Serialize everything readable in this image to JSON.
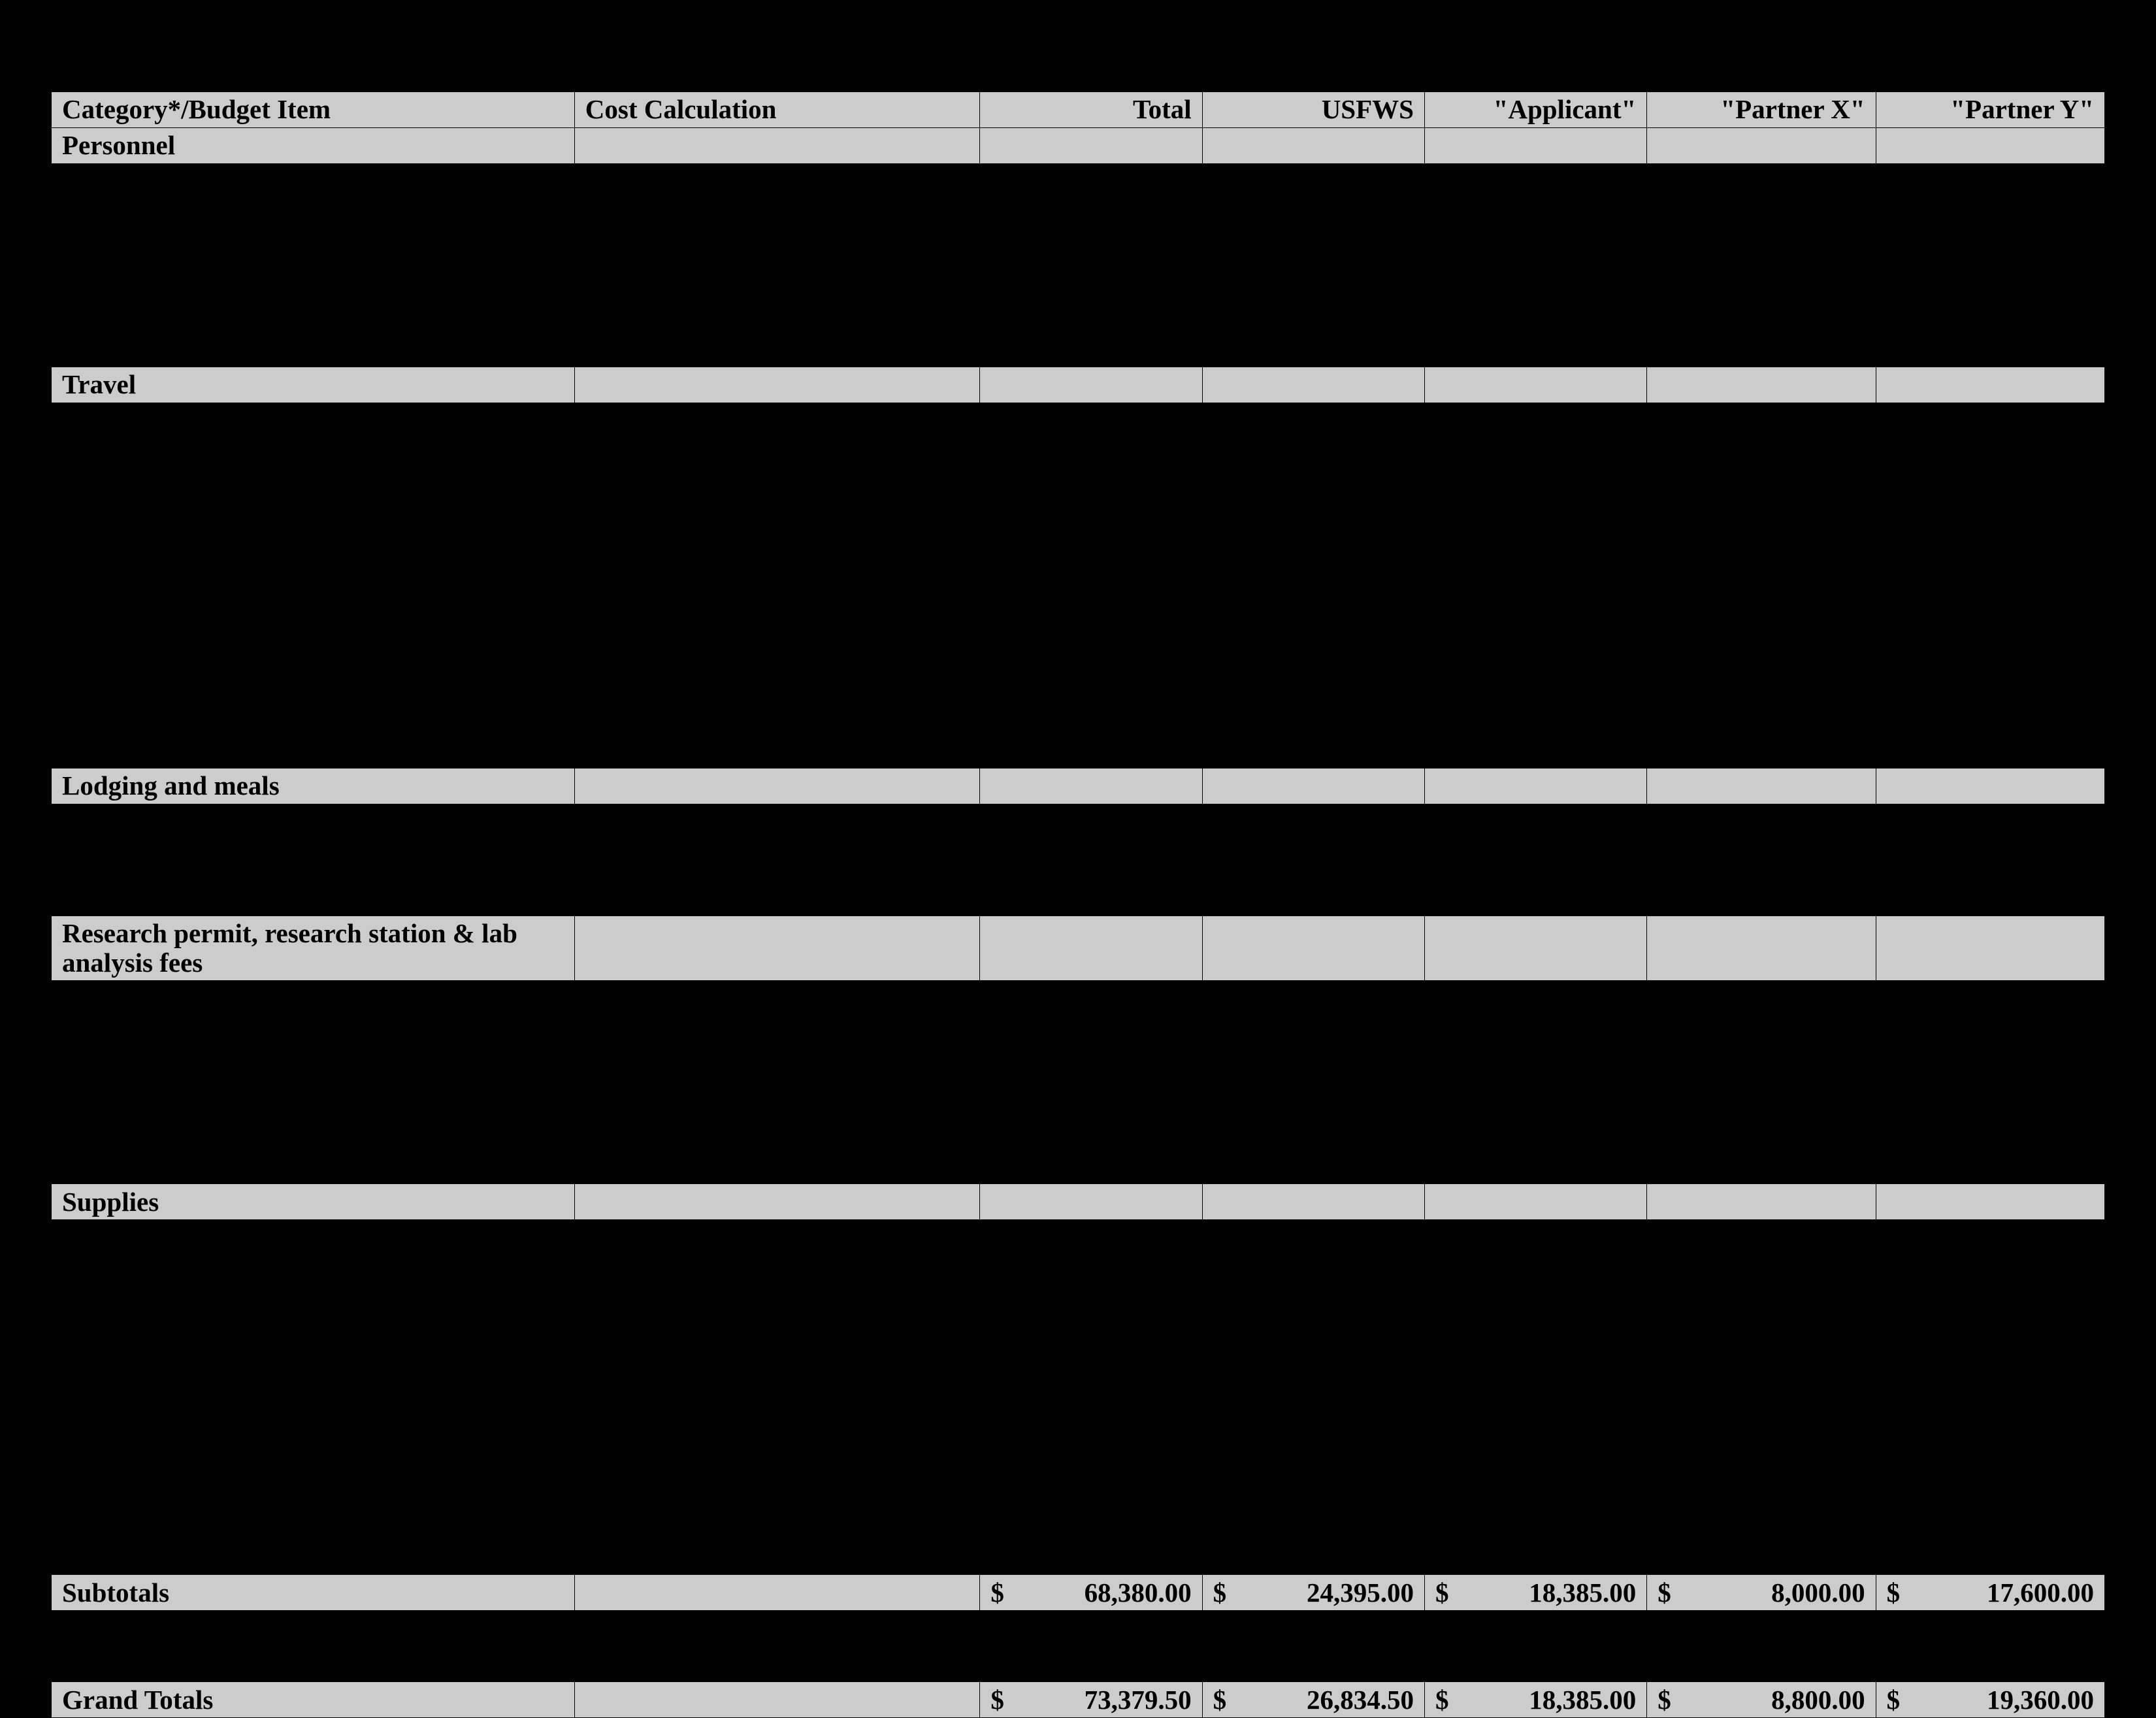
{
  "headers": [
    "Category*/Budget Item",
    "Cost Calculation",
    "Total",
    "USFWS",
    "\"Applicant\"",
    "\"Partner X\"",
    "\"Partner Y\""
  ],
  "sections": [
    {
      "label": "Personnel"
    },
    {
      "label": "Travel"
    },
    {
      "label": "Lodging and meals"
    },
    {
      "label": "Research permit, research station & lab analysis fees"
    },
    {
      "label": "Supplies"
    }
  ],
  "subtotals": {
    "label": "Subtotals",
    "vals": [
      "68,380.00",
      "24,395.00",
      "18,385.00",
      "8,000.00",
      "17,600.00"
    ]
  },
  "grand": {
    "label": "Grand Totals",
    "vals": [
      "73,379.50",
      "26,834.50",
      "18,385.00",
      "8,800.00",
      "19,360.00"
    ]
  },
  "dollar": "$"
}
